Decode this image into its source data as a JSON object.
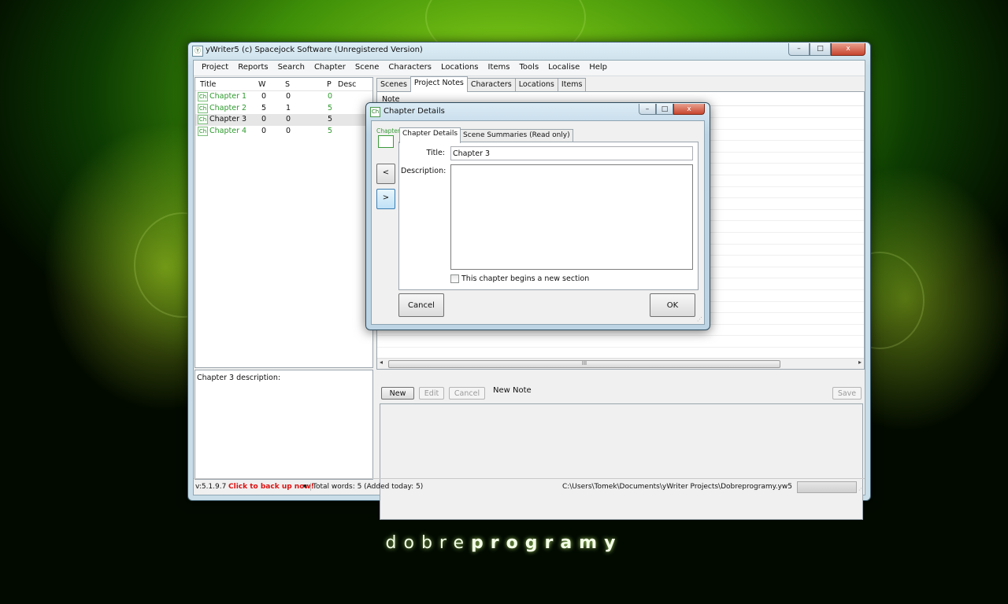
{
  "window": {
    "title": "yWriter5 (c) Spacejock Software (Unregistered Version)",
    "icon": "yw-app-icon",
    "caption": {
      "minimize": "–",
      "maximize": "□",
      "close": "x"
    }
  },
  "menubar": [
    "Project",
    "Reports",
    "Search",
    "Chapter",
    "Scene",
    "Characters",
    "Locations",
    "Items",
    "Tools",
    "Localise",
    "Help"
  ],
  "chapter_list": {
    "columns": [
      "Title",
      "W",
      "S",
      "P",
      "Desc"
    ],
    "rows": [
      {
        "icon": "Ch",
        "title": "Chapter 1",
        "w": "0",
        "s": "0",
        "p": "0",
        "color": "#2e9a2e",
        "selected": false
      },
      {
        "icon": "Ch",
        "title": "Chapter 2",
        "w": "5",
        "s": "1",
        "p": "5",
        "color": "#2e9a2e",
        "selected": false
      },
      {
        "icon": "Ch",
        "title": "Chapter 3",
        "w": "0",
        "s": "0",
        "p": "5",
        "color": "#111111",
        "selected": true
      },
      {
        "icon": "Ch",
        "title": "Chapter 4",
        "w": "0",
        "s": "0",
        "p": "5",
        "color": "#2e9a2e",
        "selected": false
      }
    ]
  },
  "chapter_description_label": "Chapter 3 description:",
  "right_tabs": [
    "Scenes",
    "Project Notes",
    "Characters",
    "Locations",
    "Items"
  ],
  "right_tabs_active": "Project Notes",
  "notes": {
    "column": "Note",
    "scroll_thumb": "III",
    "buttons": {
      "new": "New",
      "edit": "Edit",
      "cancel": "Cancel",
      "save": "Save"
    },
    "title_value": "New Note"
  },
  "statusbar": {
    "version": "v:5.1.9.7",
    "backup": "Click to back up now!",
    "dropdown": "▾",
    "words": "Total words: 5 (Added today: 5)",
    "path": "C:\\Users\\Tomek\\Documents\\yWriter Projects\\Dobreprogramy.yw5"
  },
  "dialog": {
    "title": "Chapter Details",
    "icon": "Ch",
    "side_label": "Chapter",
    "prev": "<",
    "next": ">",
    "tabs": [
      "Chapter Details",
      "Scene Summaries (Read only)"
    ],
    "title_label": "Title:",
    "title_value": "Chapter 3",
    "description_label": "Description:",
    "description_value": "",
    "new_section_label": "This chapter begins a new section",
    "new_section_checked": false,
    "cancel": "Cancel",
    "ok": "OK"
  },
  "branding": {
    "part1": "dobre",
    "part2": "programy"
  },
  "colors": {
    "accent_green": "#2e9a2e",
    "backup_red": "#dd1111",
    "desktop_green": "#3e8f08"
  }
}
